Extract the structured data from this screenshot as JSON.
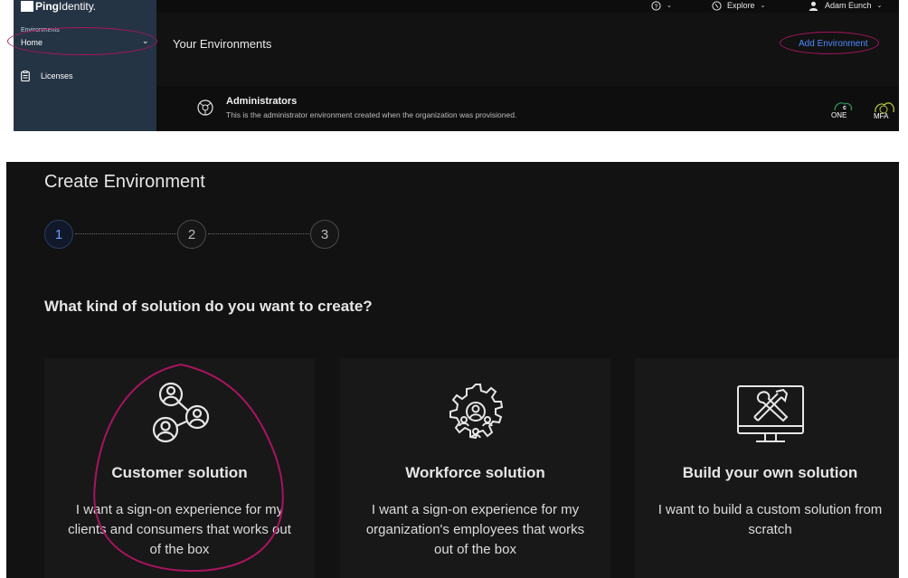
{
  "top_screenshot": {
    "brand": {
      "bold": "Ping",
      "regular": "Identity."
    },
    "sidebar": {
      "environments_label": "Environments",
      "environment_selected": "Home",
      "licenses_label": "Licenses",
      "chevron": "chevron-down-icon"
    },
    "topbar": {
      "help_icon": "help-circle-icon",
      "explore_label": "Explore",
      "user_name": "Adam Eunch"
    },
    "main": {
      "title": "Your Environments",
      "add_environment": "Add Environment",
      "environment": {
        "name": "Administrators",
        "description": "This is the administrator environment created when the organization was provisioned.",
        "products": [
          "ONE",
          "MFA"
        ]
      }
    }
  },
  "bottom_screenshot": {
    "title": "Create Environment",
    "steps": [
      "1",
      "2",
      "3"
    ],
    "active_step": 1,
    "question": "What kind of solution do you want to create?",
    "cards": [
      {
        "icon": "customer-users-icon",
        "title": "Customer solution",
        "description": "I want a sign-on experience for my clients and consumers that works out of the box"
      },
      {
        "icon": "workforce-gear-icon",
        "title": "Workforce solution",
        "description": "I want a sign-on experience for my organization's employees that works out of the box"
      },
      {
        "icon": "build-tools-monitor-icon",
        "title": "Build your own solution",
        "description": "I want to build a custom solution from scratch"
      }
    ]
  },
  "colors": {
    "accent_link": "#4a8cff",
    "annotation": "#a8145f",
    "sidebar_bg": "#243444",
    "dark_bg": "#121212"
  }
}
